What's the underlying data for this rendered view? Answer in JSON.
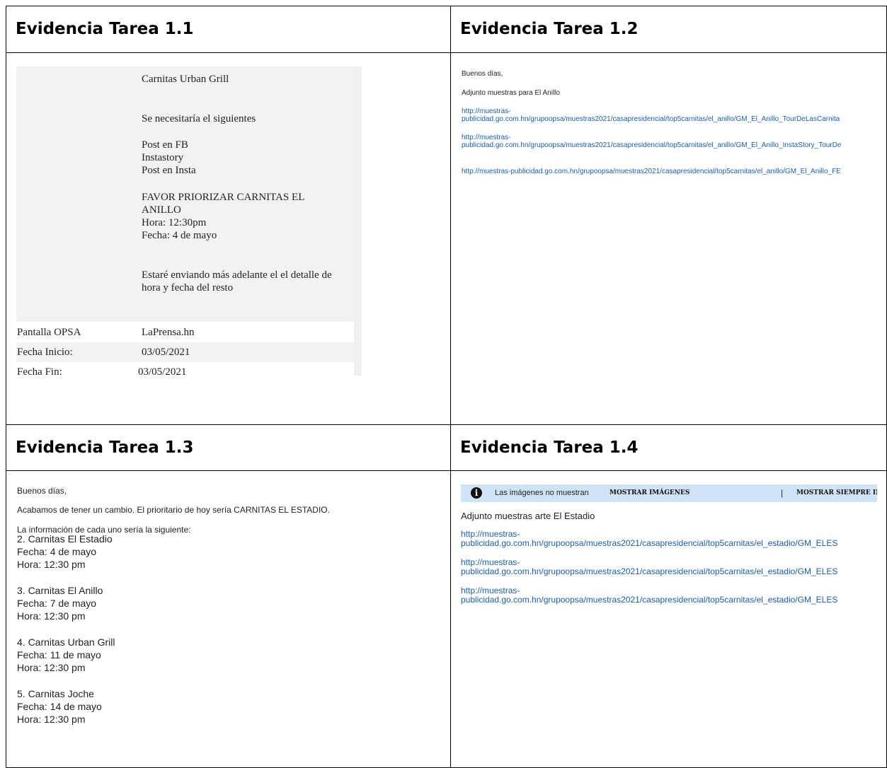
{
  "cells": {
    "t11": "Evidencia Tarea 1.1",
    "t12": "Evidencia Tarea 1.2",
    "t13": "Evidencia Tarea 1.3",
    "t14": "Evidencia Tarea 1.4"
  },
  "ev11": {
    "l1": "Carnitas Urban Grill",
    "l2": "Se necesitaría el siguientes",
    "l3": "Post en FB",
    "l4": "Instastory",
    "l5": "Post en Insta",
    "l6": "FAVOR PRIORIZAR CARNITAS EL",
    "l7": "ANILLO",
    "l8": "Hora: 12:30pm",
    "l9": "Fecha: 4 de mayo",
    "l10": "Estaré enviando más adelante el el detalle de",
    "l11": "hora y fecha del resto",
    "rows": [
      {
        "label": "Pantalla OPSA",
        "value": "LaPrensa.hn"
      },
      {
        "label": "Fecha Inicio:",
        "value": "03/05/2021"
      },
      {
        "label": "Fecha Fin:",
        "value": "03/05/2021"
      }
    ]
  },
  "ev12": {
    "greet": "Buenos días,",
    "intro": "Adjunto muestras para El Anillo",
    "links": [
      {
        "a": "http://muestras-",
        "b": "publicidad.go.com.hn/grupoopsa/muestras2021/casapresidencial/top5carnitas/el_anillo/GM_El_Anillo_TourDeLasCarnita"
      },
      {
        "a": "http://muestras-",
        "b": "publicidad.go.com.hn/grupoopsa/muestras2021/casapresidencial/top5carnitas/el_anillo/GM_El_Anillo_InstaStory_TourDe"
      },
      {
        "a": "http://muestras-publicidad.go.com.hn/grupoopsa/muestras2021/casapresidencial/top5carnitas/el_anillo/GM_El_Anillo_FE",
        "b": ""
      }
    ]
  },
  "ev13": {
    "greet": "Buenos días,",
    "change": "Acabamos de tener un cambio. El prioritario de hoy sería  CARNITAS EL ESTADIO.",
    "info": "La información de cada uno sería la siguiente:",
    "items": [
      {
        "name": "2. Carnitas El Estadio",
        "date": "Fecha: 4 de mayo",
        "time": "Hora: 12:30 pm"
      },
      {
        "name": "3. Carnitas El Anillo",
        "date": "Fecha: 7 de mayo",
        "time": "Hora: 12:30 pm"
      },
      {
        "name": "4. Carnitas Urban Grill",
        "date": "Fecha: 11 de mayo",
        "time": "Hora: 12:30 pm"
      },
      {
        "name": "5. Carnitas Joche",
        "date": "Fecha: 14 de mayo",
        "time": "Hora: 12:30 pm"
      }
    ]
  },
  "ev14": {
    "banner_msg": "Las imágenes no muestran",
    "show_images": "MOSTRAR IMÁGENES",
    "separator": "|",
    "always_show": "MOSTRAR SIEMPRE IMÁGENES A ESTE REMITENTE",
    "intro": "Adjunto muestras arte El Estadio",
    "links": [
      {
        "a": "http://muestras-",
        "b": "publicidad.go.com.hn/grupoopsa/muestras2021/casapresidencial/top5carnitas/el_estadio/GM_ELES"
      },
      {
        "a": "http://muestras-",
        "b": "publicidad.go.com.hn/grupoopsa/muestras2021/casapresidencial/top5carnitas/el_estadio/GM_ELES"
      },
      {
        "a": "http://muestras-",
        "b": "publicidad.go.com.hn/grupoopsa/muestras2021/casapresidencial/top5carnitas/el_estadio/GM_ELES"
      }
    ]
  },
  "colors": {
    "border": "#000000",
    "link": "#1a5fb4",
    "banner": "#cfe4f6",
    "mailbox_bg": "#f2f2f2"
  }
}
